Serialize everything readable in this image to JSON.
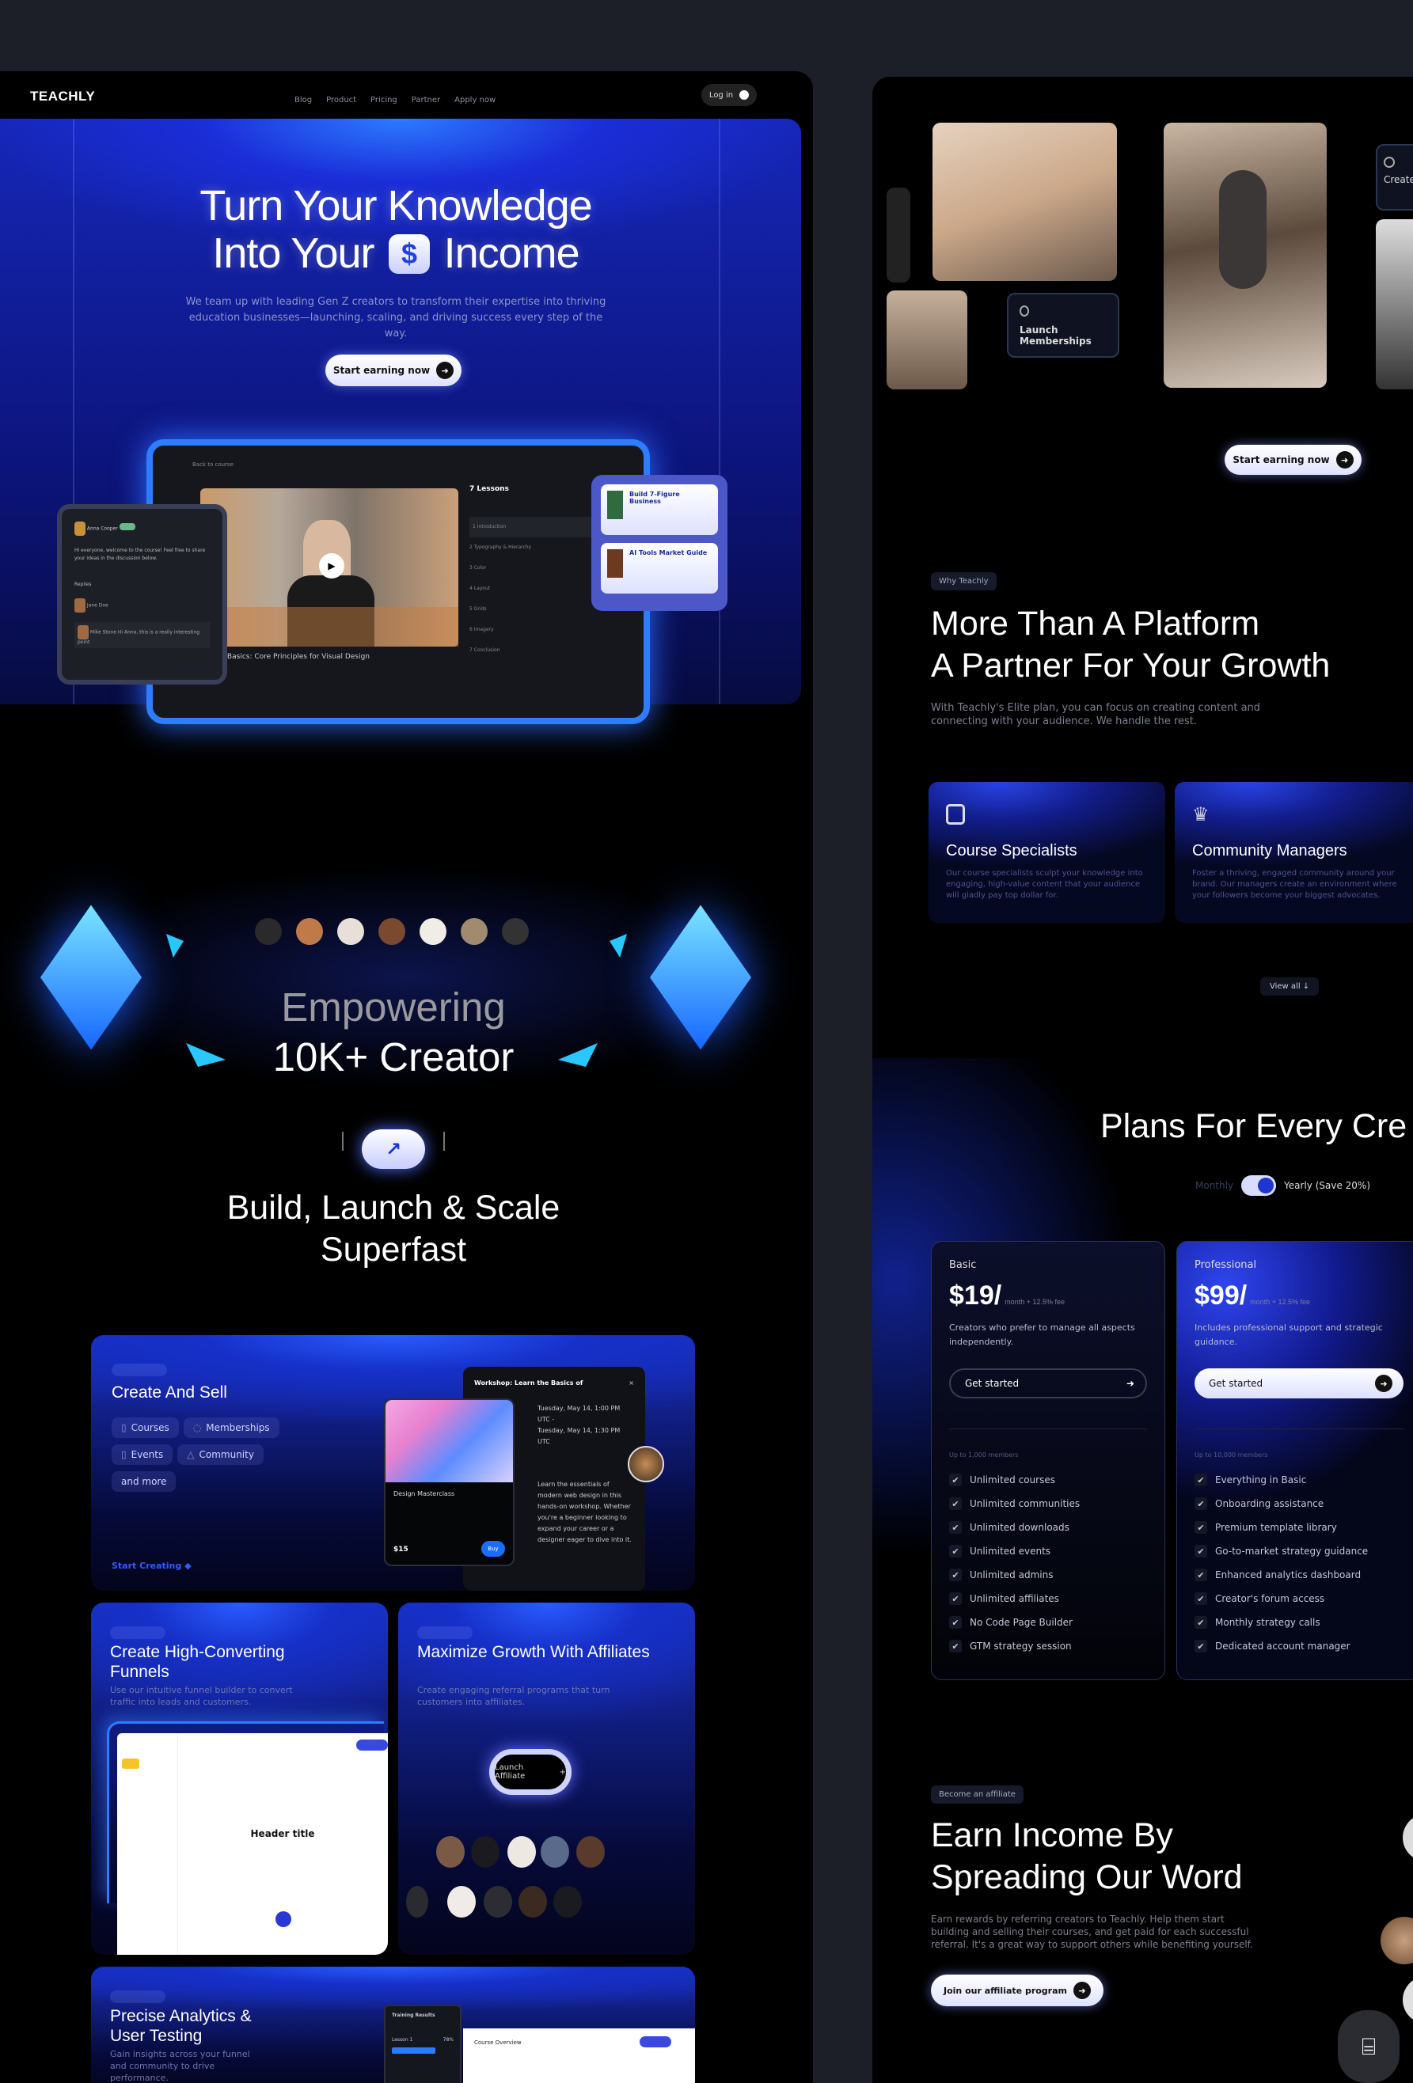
{
  "nav": {
    "logo": "TEACHLY",
    "links": [
      "Blog",
      "Product",
      "Pricing",
      "Partner",
      "Apply now"
    ],
    "login": "Log in"
  },
  "hero": {
    "title_line1": "Turn Your Knowledge",
    "title_line2_a": "Into Your",
    "title_line2_icon": "$",
    "title_line2_b": "Income",
    "subtitle": "We team up with leading Gen Z creators to transform their expertise into thriving education businesses—launching, scaling, and driving success every step of the way.",
    "cta": "Start earning now"
  },
  "mockup": {
    "back": "Back to course",
    "video_title": "Design Basics: Core Principles for Visual Design",
    "lessons_title": "7 Lessons",
    "lessons": [
      "Introduction",
      "Typography & Hierarchy",
      "Color",
      "Layout",
      "Grids",
      "Imagery",
      "Conclusion"
    ],
    "chat_author": "Anna Cooper",
    "chat_msg": "Hi everyone, welcome to the course! Feel free to share your ideas in the discussion below.",
    "replies_label": "Replies",
    "reply1_name": "Jane Doe",
    "reply2_name": "Mike Stone",
    "reply2_msg": "Hi Anna, this is a really interesting point",
    "book1": "Build 7-Figure Business",
    "book2": "AI Tools Market Guide"
  },
  "empower": {
    "line1": "Empowering",
    "line2": "10K+ Creator"
  },
  "build": {
    "title_line1": "Build, Launch & Scale",
    "title_line2": "Superfast"
  },
  "features": {
    "create": {
      "title": "Create And Sell",
      "chips": [
        "Courses",
        "Memberships",
        "Events",
        "Community",
        "and more"
      ],
      "link": "Start Creating",
      "product_title": "Design Masterclass",
      "product_price": "$15",
      "product_btn": "Buy",
      "workshop_title": "Workshop: Learn the Basics of",
      "workshop_date1": "Tuesday, May 14, 1:00 PM UTC -",
      "workshop_date2": "Tuesday, May 14, 1:30 PM UTC",
      "workshop_desc": "Learn the essentials of modern web design in this hands-on workshop. Whether you're a beginner looking to expand your career or a designer eager to dive into it."
    },
    "funnels": {
      "title": "Create High-Converting Funnels",
      "desc": "Use our intuitive funnel builder to convert traffic into leads and customers.",
      "builder_heading": "Header title"
    },
    "affiliates": {
      "title": "Maximize Growth With Affiliates",
      "desc": "Create engaging referral programs that turn customers into affiliates.",
      "button": "Launch Affiliate"
    },
    "analytics": {
      "title": "Precise Analytics & User Testing",
      "desc": "Gain insights across your funnel and community to drive performance.",
      "panel_title": "Training Results",
      "panel_row": "Lesson 1",
      "panel_value": "78%",
      "overview": "Course Overview"
    }
  },
  "gallery": {
    "card1": "Launch Memberships",
    "card2": "Create",
    "cta": "Start earning now"
  },
  "why": {
    "badge": "Why Teachly",
    "title_line1": "More Than A Platform",
    "title_line2": "A Partner For Your Growth",
    "desc": "With Teachly's Elite plan, you can focus on creating content and connecting with your audience. We handle the rest.",
    "cards": [
      {
        "title": "Course Specialists",
        "desc": "Our course specialists sculpt your knowledge into engaging, high-value content that your audience will gladly pay top dollar for."
      },
      {
        "title": "Community Managers",
        "desc": "Foster a thriving, engaged community around your brand. Our managers create an environment where your followers become your biggest advocates."
      }
    ],
    "view_all": "View all"
  },
  "plans": {
    "title": "Plans For Every Cre",
    "toggle_monthly": "Monthly",
    "toggle_yearly": "Yearly (Save 20%)",
    "yearly_selected": true,
    "basic": {
      "name": "Basic",
      "price": "$19/",
      "suffix": "month + 12.5% fee",
      "desc": "Creators who prefer to manage all aspects independently.",
      "cta": "Get started",
      "cap": "Up to 1,000 members",
      "features": [
        "Unlimited courses",
        "Unlimited communities",
        "Unlimited downloads",
        "Unlimited events",
        "Unlimited admins",
        "Unlimited affiliates",
        "No Code Page Builder",
        "GTM strategy session"
      ]
    },
    "pro": {
      "name": "Professional",
      "price": "$99/",
      "suffix": "month + 12.5% fee",
      "desc": "Includes professional support and strategic guidance.",
      "cta": "Get started",
      "cap": "Up to 10,000 members",
      "features": [
        "Everything in Basic",
        "Onboarding assistance",
        "Premium template library",
        "Go-to-market strategy guidance",
        "Enhanced analytics dashboard",
        "Creator's forum access",
        "Monthly strategy calls",
        "Dedicated account manager"
      ]
    }
  },
  "affiliate": {
    "badge": "Become an affiliate",
    "title_line1": "Earn Income By",
    "title_line2": "Spreading Our Word",
    "desc": "Earn rewards by referring creators to Teachly. Help them start building and selling their courses, and get paid for each successful referral. It's a great way to support others while benefiting yourself.",
    "cta": "Join our affiliate program"
  },
  "colors": {
    "accent": "#1f35d8",
    "glow": "#2e7cff",
    "page_bg": "#1c1f27",
    "panel_bg": "#000000"
  },
  "icons": [
    "arrow-right-icon",
    "dollar-icon",
    "play-icon",
    "trend-up-icon",
    "book-icon",
    "crown-icon",
    "check-icon",
    "scan-text-icon",
    "plus-icon",
    "close-icon"
  ]
}
